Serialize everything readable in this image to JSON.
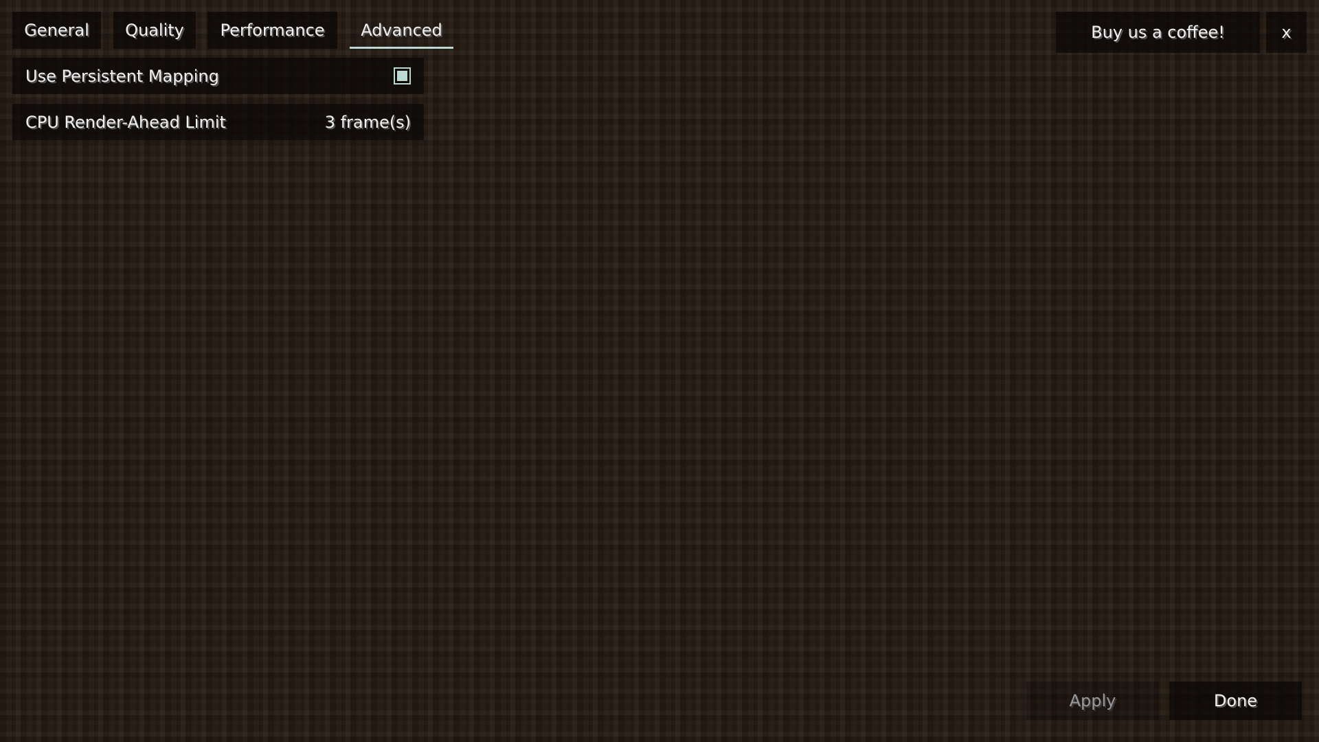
{
  "tabs": [
    {
      "label": "General",
      "active": false
    },
    {
      "label": "Quality",
      "active": false
    },
    {
      "label": "Performance",
      "active": false
    },
    {
      "label": "Advanced",
      "active": true
    }
  ],
  "settings": [
    {
      "label": "Use Persistent Mapping",
      "type": "checkbox",
      "checked": true
    },
    {
      "label": "CPU Render-Ahead Limit",
      "type": "value",
      "value": "3 frame(s)"
    }
  ],
  "header": {
    "donate_label": "Buy us a coffee!",
    "close_label": "x"
  },
  "footer": {
    "apply_label": "Apply",
    "apply_enabled": false,
    "done_label": "Done"
  },
  "colors": {
    "accent": "#b9d9d2",
    "background": "#2b2018"
  }
}
